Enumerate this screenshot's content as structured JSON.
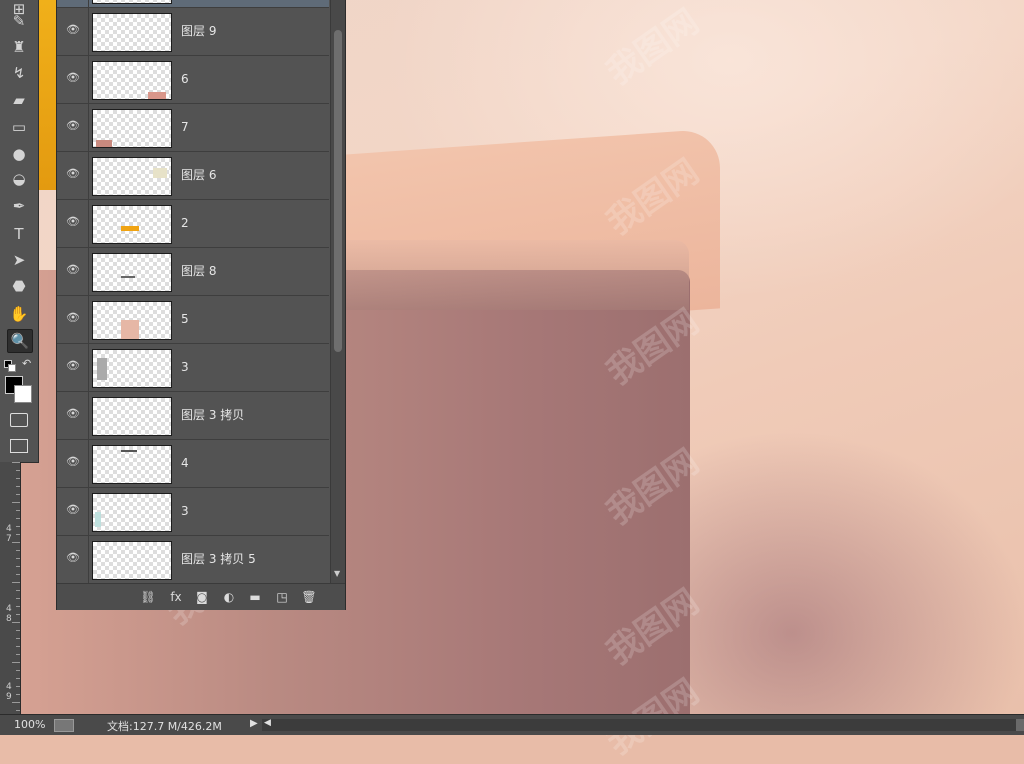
{
  "toolbar": {
    "tools": [
      {
        "name": "crop-tool-icon",
        "glyph": "⊞"
      },
      {
        "name": "brush-tool-icon",
        "glyph": "✎"
      },
      {
        "name": "clone-stamp-tool-icon",
        "glyph": "♜"
      },
      {
        "name": "history-brush-tool-icon",
        "glyph": "↯"
      },
      {
        "name": "eraser-tool-icon",
        "glyph": "▰"
      },
      {
        "name": "gradient-tool-icon",
        "glyph": "▭"
      },
      {
        "name": "blur-tool-icon",
        "glyph": "●"
      },
      {
        "name": "dodge-tool-icon",
        "glyph": "◒"
      },
      {
        "name": "pen-tool-icon",
        "glyph": "✒"
      },
      {
        "name": "type-tool-icon",
        "glyph": "T"
      },
      {
        "name": "path-selection-tool-icon",
        "glyph": "➤"
      },
      {
        "name": "shape-tool-icon",
        "glyph": "⬣"
      },
      {
        "name": "hand-tool-icon",
        "glyph": "✋"
      },
      {
        "name": "zoom-tool-icon",
        "glyph": "🔍"
      }
    ],
    "foreground_color": "#000000",
    "background_color": "#ffffff"
  },
  "ruler": {
    "labels": [
      "4\n7",
      "4\n8",
      "4\n9"
    ]
  },
  "layers_panel": {
    "layers": [
      {
        "name": "",
        "visible": true,
        "selected": true
      },
      {
        "name": "图层 9",
        "visible": true
      },
      {
        "name": "6",
        "visible": true
      },
      {
        "name": "7",
        "visible": true
      },
      {
        "name": "图层 6",
        "visible": true
      },
      {
        "name": "2",
        "visible": true
      },
      {
        "name": "图层 8",
        "visible": true
      },
      {
        "name": "5",
        "visible": true
      },
      {
        "name": "3",
        "visible": true
      },
      {
        "name": "图层 3 拷贝",
        "visible": true
      },
      {
        "name": "4",
        "visible": true
      },
      {
        "name": "3",
        "visible": true
      },
      {
        "name": "图层 3 拷贝 5",
        "visible": true
      }
    ],
    "footer_icons": [
      "link-layers-icon",
      "fx-icon",
      "add-mask-icon",
      "adjustment-layer-icon",
      "new-group-icon",
      "new-layer-icon",
      "delete-layer-icon"
    ],
    "footer_glyphs": [
      "⛓",
      "fx",
      "◙",
      "◐",
      "▬",
      "◳",
      "🗑"
    ]
  },
  "status_bar": {
    "zoom": "100%",
    "doc_info": "文档:127.7 M/426.2M"
  },
  "watermark": "我图网"
}
